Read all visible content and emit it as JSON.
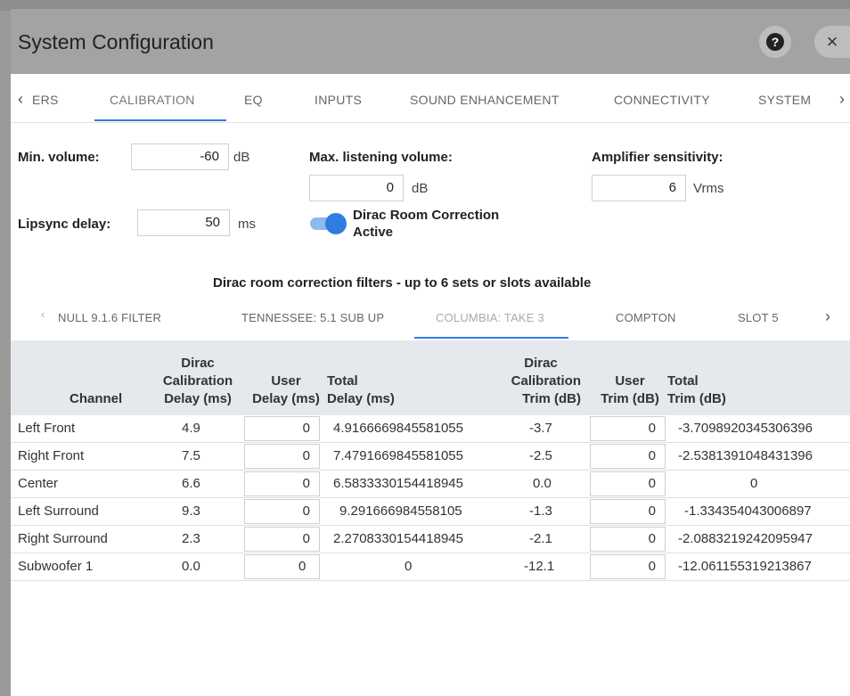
{
  "window": {
    "title": "System Configuration"
  },
  "tabs": {
    "items": [
      "ERS",
      "CALIBRATION",
      "EQ",
      "INPUTS",
      "SOUND ENHANCEMENT",
      "CONNECTIVITY",
      "SYSTEM"
    ],
    "active": "CALIBRATION"
  },
  "settings": {
    "min_volume": {
      "label": "Min. volume:",
      "value": "-60",
      "unit": "dB"
    },
    "lipsync_delay": {
      "label": "Lipsync delay:",
      "value": "50",
      "unit": "ms"
    },
    "max_listening_volume": {
      "label": "Max. listening volume:",
      "value": "0",
      "unit": "dB"
    },
    "dirac_toggle": {
      "label_line1": "Dirac Room Correction",
      "label_line2": "Active",
      "on": true
    },
    "amp_sensitivity": {
      "label": "Amplifier sensitivity:",
      "value": "6",
      "unit": "Vrms"
    }
  },
  "filters": {
    "title": "Dirac room correction filters - up to 6 sets or slots available",
    "slots": [
      "NULL 9.1.6 FILTER",
      "TENNESSEE: 5.1 SUB UP",
      "COLUMBIA: TAKE 3",
      "COMPTON",
      "SLOT 5"
    ],
    "active": "COLUMBIA: TAKE 3"
  },
  "table": {
    "headers": {
      "channel": "Channel",
      "dirac_delay": [
        "Dirac",
        "Calibration",
        "Delay (ms)"
      ],
      "user_delay": [
        "User",
        "Delay (ms)"
      ],
      "total_delay": [
        "Total",
        "Delay (ms)"
      ],
      "dirac_trim": [
        "Dirac",
        "Calibration",
        "Trim (dB)"
      ],
      "user_trim": [
        "User",
        "Trim (dB)"
      ],
      "total_trim": [
        "Total",
        "Trim (dB)"
      ]
    },
    "rows": [
      {
        "channel": "Left Front",
        "dirac_delay": "4.9",
        "user_delay": "0",
        "total_delay": "4.9166669845581055",
        "dirac_trim": "-3.7",
        "user_trim": "0",
        "total_trim": "-3.7098920345306396"
      },
      {
        "channel": "Right Front",
        "dirac_delay": "7.5",
        "user_delay": "0",
        "total_delay": "7.4791669845581055",
        "dirac_trim": "-2.5",
        "user_trim": "0",
        "total_trim": "-2.5381391048431396"
      },
      {
        "channel": "Center",
        "dirac_delay": "6.6",
        "user_delay": "0",
        "total_delay": "6.5833330154418945",
        "dirac_trim": "0.0",
        "user_trim": "0",
        "total_trim": "0"
      },
      {
        "channel": "Left Surround",
        "dirac_delay": "9.3",
        "user_delay": "0",
        "total_delay": "9.291666984558105",
        "dirac_trim": "-1.3",
        "user_trim": "0",
        "total_trim": "-1.334354043006897"
      },
      {
        "channel": "Right Surround",
        "dirac_delay": "2.3",
        "user_delay": "0",
        "total_delay": "2.2708330154418945",
        "dirac_trim": "-2.1",
        "user_trim": "0",
        "total_trim": "-2.0883219242095947"
      },
      {
        "channel": "Subwoofer 1",
        "dirac_delay": "0.0",
        "user_delay": "0",
        "total_delay": "0",
        "dirac_trim": "-12.1",
        "user_trim": "0",
        "total_trim": "-12.061155319213867"
      }
    ]
  },
  "icons": {
    "help": "help-icon",
    "close": "close-icon",
    "tab_prev": "chevron-left-icon",
    "tab_next": "chevron-right-icon"
  },
  "colors": {
    "accent": "#2f7de1",
    "titlebar": "#a3a3a3",
    "table_header": "#e5e8ec"
  }
}
